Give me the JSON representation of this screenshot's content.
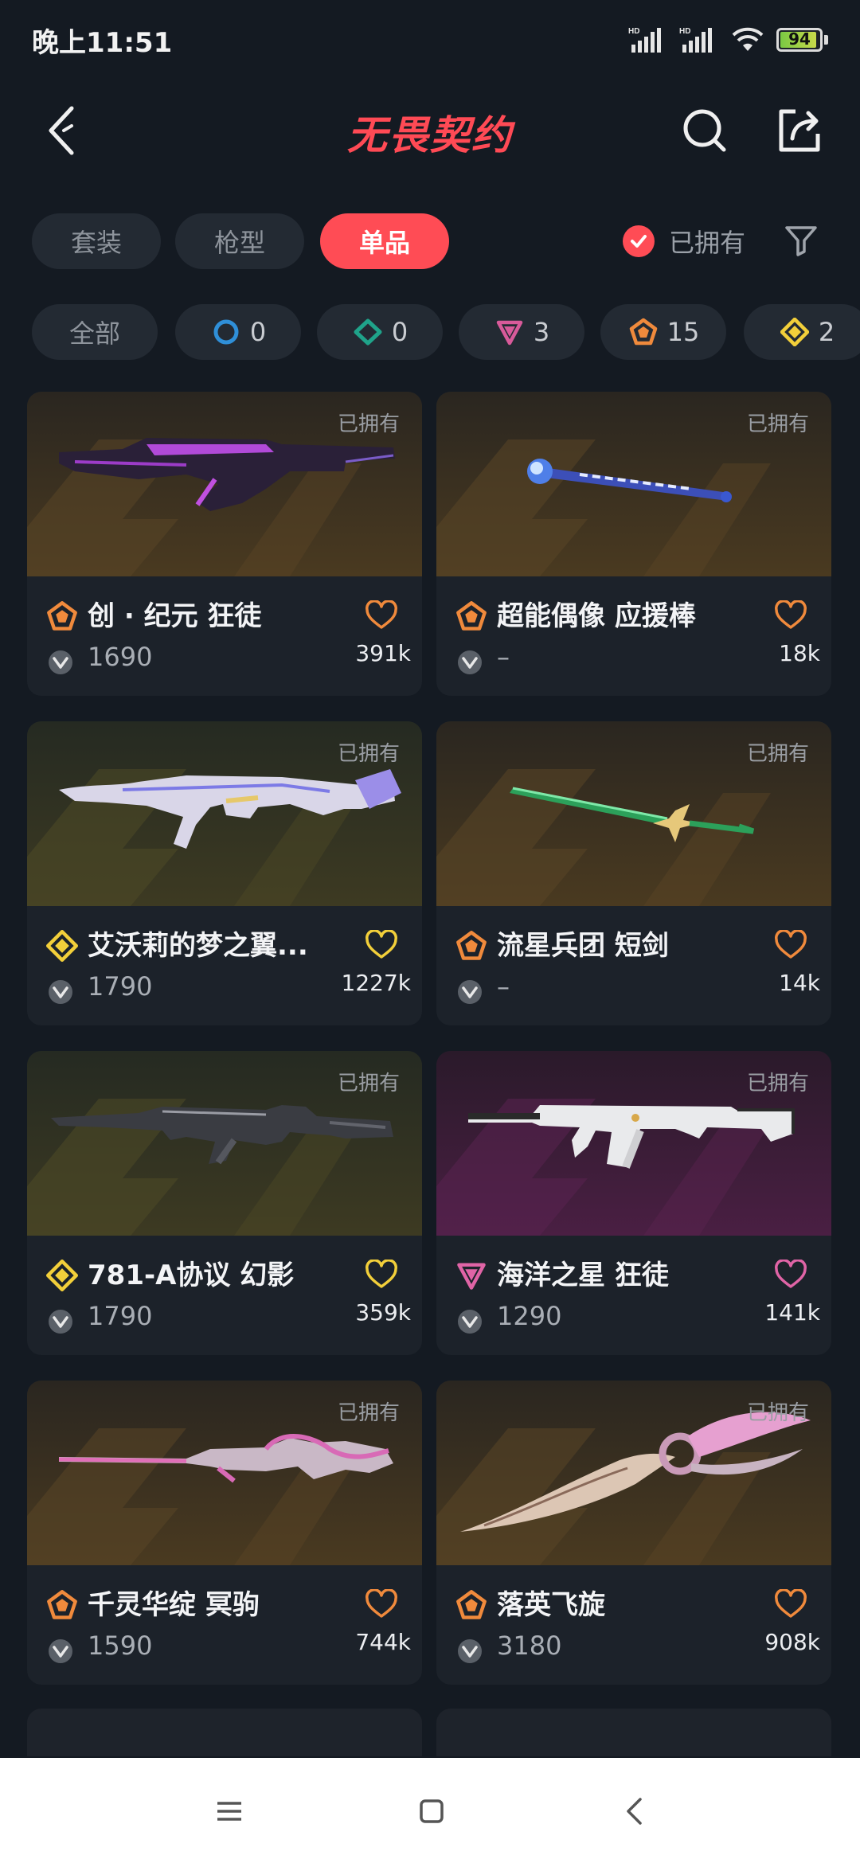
{
  "status_bar": {
    "time": "晚上11:51",
    "battery": 94,
    "battery_text": "94"
  },
  "header": {
    "title": "无畏契约"
  },
  "tabs": [
    {
      "label": "套装",
      "active": false
    },
    {
      "label": "枪型",
      "active": false
    },
    {
      "label": "单品",
      "active": true
    }
  ],
  "owned_filter": {
    "label": "已拥有",
    "checked": true
  },
  "rarity_filters": [
    {
      "label": "全部",
      "icon": "all"
    },
    {
      "label": "0",
      "icon": "select-tier-icon",
      "color": "#2f8fd8"
    },
    {
      "label": "0",
      "icon": "deluxe-tier-icon",
      "color": "#1fa38a"
    },
    {
      "label": "3",
      "icon": "premium-tier-icon",
      "color": "#d85a9a"
    },
    {
      "label": "15",
      "icon": "exclusive-tier-icon",
      "color": "#f08a3c"
    },
    {
      "label": "2",
      "icon": "ultra-tier-icon",
      "color": "#f2cf3a"
    }
  ],
  "items": [
    {
      "name": "创 · 纪元 狂徒",
      "price": "1690",
      "likes": "391k",
      "owned_tag": "已拥有",
      "tier": "exclusive",
      "bg": "orange"
    },
    {
      "name": "超能偶像 应援棒",
      "price": "–",
      "likes": "18k",
      "owned_tag": "已拥有",
      "tier": "exclusive",
      "bg": "orange"
    },
    {
      "name": "艾沃莉的梦之翼...",
      "price": "1790",
      "likes": "1227k",
      "owned_tag": "已拥有",
      "tier": "ultra",
      "bg": "yellow"
    },
    {
      "name": "流星兵团 短剑",
      "price": "–",
      "likes": "14k",
      "owned_tag": "已拥有",
      "tier": "exclusive",
      "bg": "orange"
    },
    {
      "name": "781-A协议 幻影",
      "price": "1790",
      "likes": "359k",
      "owned_tag": "已拥有",
      "tier": "ultra",
      "bg": "yellow"
    },
    {
      "name": "海洋之星 狂徒",
      "price": "1290",
      "likes": "141k",
      "owned_tag": "已拥有",
      "tier": "premium",
      "bg": "pink"
    },
    {
      "name": "千灵华绽 冥驹",
      "price": "1590",
      "likes": "744k",
      "owned_tag": "已拥有",
      "tier": "exclusive",
      "bg": "orange"
    },
    {
      "name": "落英飞旋",
      "price": "3180",
      "likes": "908k",
      "owned_tag": "已拥有",
      "tier": "exclusive",
      "bg": "orange"
    }
  ],
  "colors": {
    "accent": "#ff4c55",
    "background": "#141a22",
    "card": "#1c222a",
    "exclusive": "#f08a3c",
    "ultra": "#f2cf3a",
    "premium": "#e064a6"
  },
  "system_nav": [
    "menu-icon",
    "home-icon",
    "back-icon"
  ]
}
